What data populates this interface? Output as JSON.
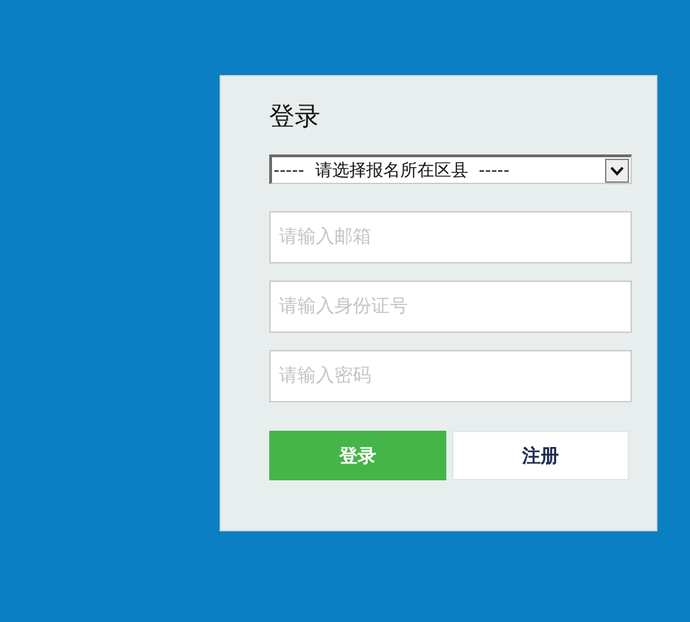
{
  "login_form": {
    "title": "登录",
    "district_select": {
      "value": "-----  请选择报名所在区县  -----"
    },
    "fields": [
      {
        "placeholder": "请输入邮箱"
      },
      {
        "placeholder": "请输入身份证号"
      },
      {
        "placeholder": "请输入密码"
      }
    ],
    "buttons": [
      {
        "label": "登录",
        "kind": "primary"
      },
      {
        "label": "注册",
        "kind": "secondary"
      }
    ]
  }
}
